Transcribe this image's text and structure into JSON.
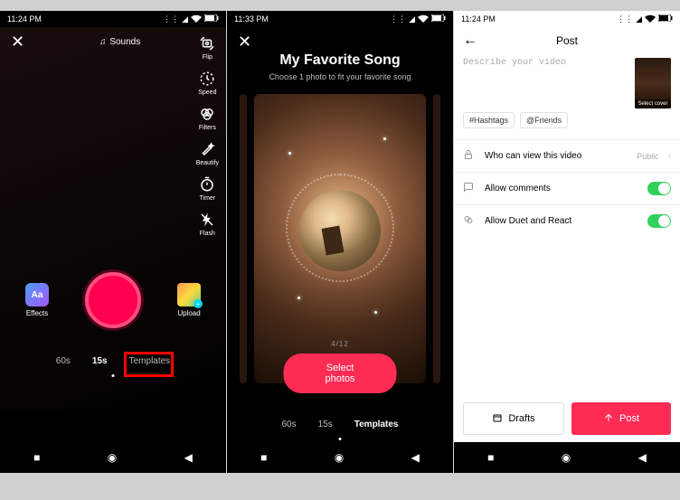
{
  "screen1": {
    "time": "11:24 PM",
    "sounds": "Sounds",
    "tools": {
      "flip": "Flip",
      "speed": "Speed",
      "filters": "Filters",
      "beautify": "Beautify",
      "timer": "Timer",
      "flash": "Flash"
    },
    "effects": "Effects",
    "upload": "Upload",
    "tabs": {
      "t60": "60s",
      "t15": "15s",
      "templates": "Templates"
    }
  },
  "screen2": {
    "time": "11:33 PM",
    "title": "My Favorite Song",
    "subtitle": "Choose 1 photo to fit your favorite song",
    "counter": "4/12",
    "select": "Select photos",
    "tabs": {
      "t60": "60s",
      "t15": "15s",
      "templates": "Templates"
    }
  },
  "screen3": {
    "time": "11:24 PM",
    "header": "Post",
    "desc_ph": "Describe your video",
    "cover": "Select cover",
    "hashtags": "#Hashtags",
    "friends": "@Friends",
    "who": "Who can view this video",
    "who_val": "Public",
    "comments": "Allow comments",
    "duet": "Allow Duet and React",
    "drafts": "Drafts",
    "post": "Post"
  }
}
